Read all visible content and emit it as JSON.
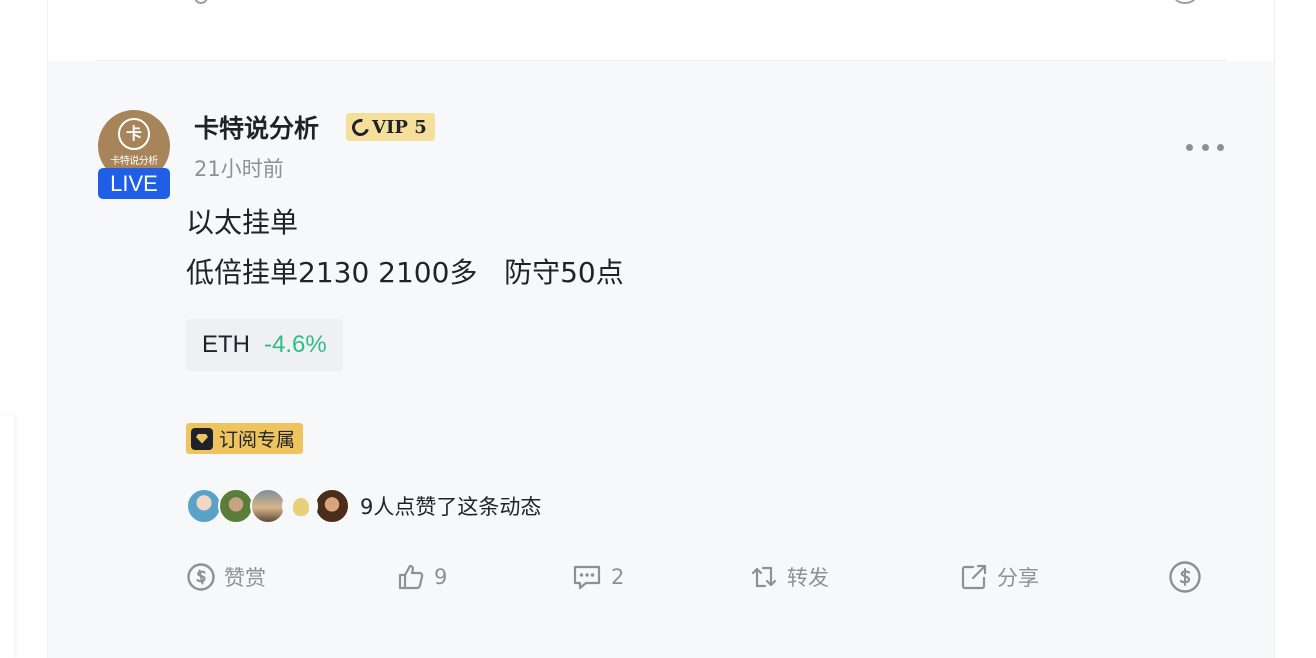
{
  "post": {
    "author": {
      "name": "卡特说分析",
      "avatar_text": "卡特说分析",
      "avatar_emblem": "卡",
      "live_label": "LIVE",
      "vip_label": "VIP 5"
    },
    "timestamp": "21小时前",
    "content": {
      "line1": "以太挂单",
      "line2": "低倍挂单2130 2100多   防守50点"
    },
    "ticker": {
      "symbol": "ETH",
      "change": "-4.6%"
    },
    "subscription_badge": "订阅专属",
    "likes_summary": "9人点赞了这条动态",
    "actions": {
      "tip_label": "赞赏",
      "like_count": "9",
      "comment_count": "2",
      "repost_label": "转发",
      "share_label": "分享"
    }
  },
  "colors": {
    "live_blue": "#1f5fe8",
    "vip_gold": "#f6df9c",
    "badge_gold": "#f0c45c",
    "change_green": "#2ebd85",
    "muted_text": "#8c9199"
  },
  "icons": [
    "tip-icon",
    "thumbs-up-icon",
    "comment-icon",
    "repost-icon",
    "share-icon",
    "coin-icon",
    "more-icon",
    "vip-icon",
    "diamond-icon"
  ]
}
